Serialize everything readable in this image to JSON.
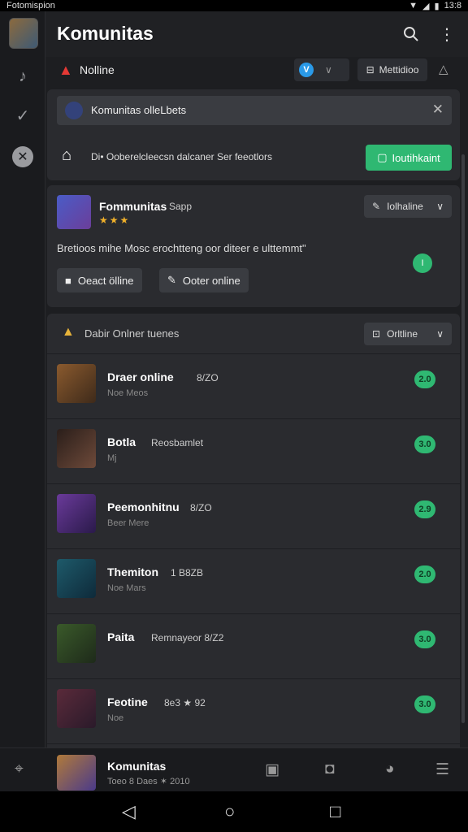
{
  "status": {
    "left": "Fotomispion",
    "time": "13:8"
  },
  "header": {
    "title": "Komunitas"
  },
  "notice": {
    "label": "Nolline",
    "toggle_glyph": "V",
    "button_label": "Mettidioo"
  },
  "card1": {
    "search_text": "Komunitas olleLbets",
    "message": "Di• Ooberelcleecsn dalcaner Ser feeotlors",
    "action_label": "Ioutihkaint"
  },
  "card2": {
    "name": "Fommunitas",
    "sub": "Sapp",
    "stars": "★★★",
    "dropdown": "Iolhaline",
    "quote": "Bretioos mihe Mosc erochtteng oor diteer e ulttemmt\"",
    "online_badge": "I",
    "btn1": "Oeact ölline",
    "btn2": "Ooter online"
  },
  "list": {
    "header": "Dabir Onlner tuenes",
    "dropdown": "Orltline",
    "rows": [
      {
        "name": "Draer online",
        "meta": "8/ZO",
        "sub": "Noe Meos",
        "count": "2.0",
        "colors": [
          "#8a5a2e",
          "#3e2a1a"
        ]
      },
      {
        "name": "Botla",
        "meta": "Reosbamlet",
        "sub": "Mj",
        "count": "3.0",
        "colors": [
          "#2a1e1a",
          "#6e4a3a"
        ]
      },
      {
        "name": "Peemonhitnu",
        "meta": "8/ZO",
        "sub": "Beer Mere",
        "count": "2.9",
        "colors": [
          "#6a3a9a",
          "#2a1a4a"
        ]
      },
      {
        "name": "Themiton",
        "meta": "1 B8ZB",
        "sub": "Noe Mars",
        "count": "2.0",
        "colors": [
          "#1e5a6a",
          "#0e2a3a"
        ]
      },
      {
        "name": "Paita",
        "meta": "Remnayeor  8/Z2",
        "sub": "",
        "count": "3.0",
        "colors": [
          "#3a5a2a",
          "#1e2a1a"
        ]
      },
      {
        "name": "Feotine",
        "meta": "8e3  ★ 92",
        "sub": "Noe",
        "count": "3.0",
        "colors": [
          "#5a2a3a",
          "#2a1a2a"
        ]
      }
    ]
  },
  "bottom": {
    "name": "Komunitas",
    "sub": "Toeo  8 Daes  ✶ 2010"
  }
}
